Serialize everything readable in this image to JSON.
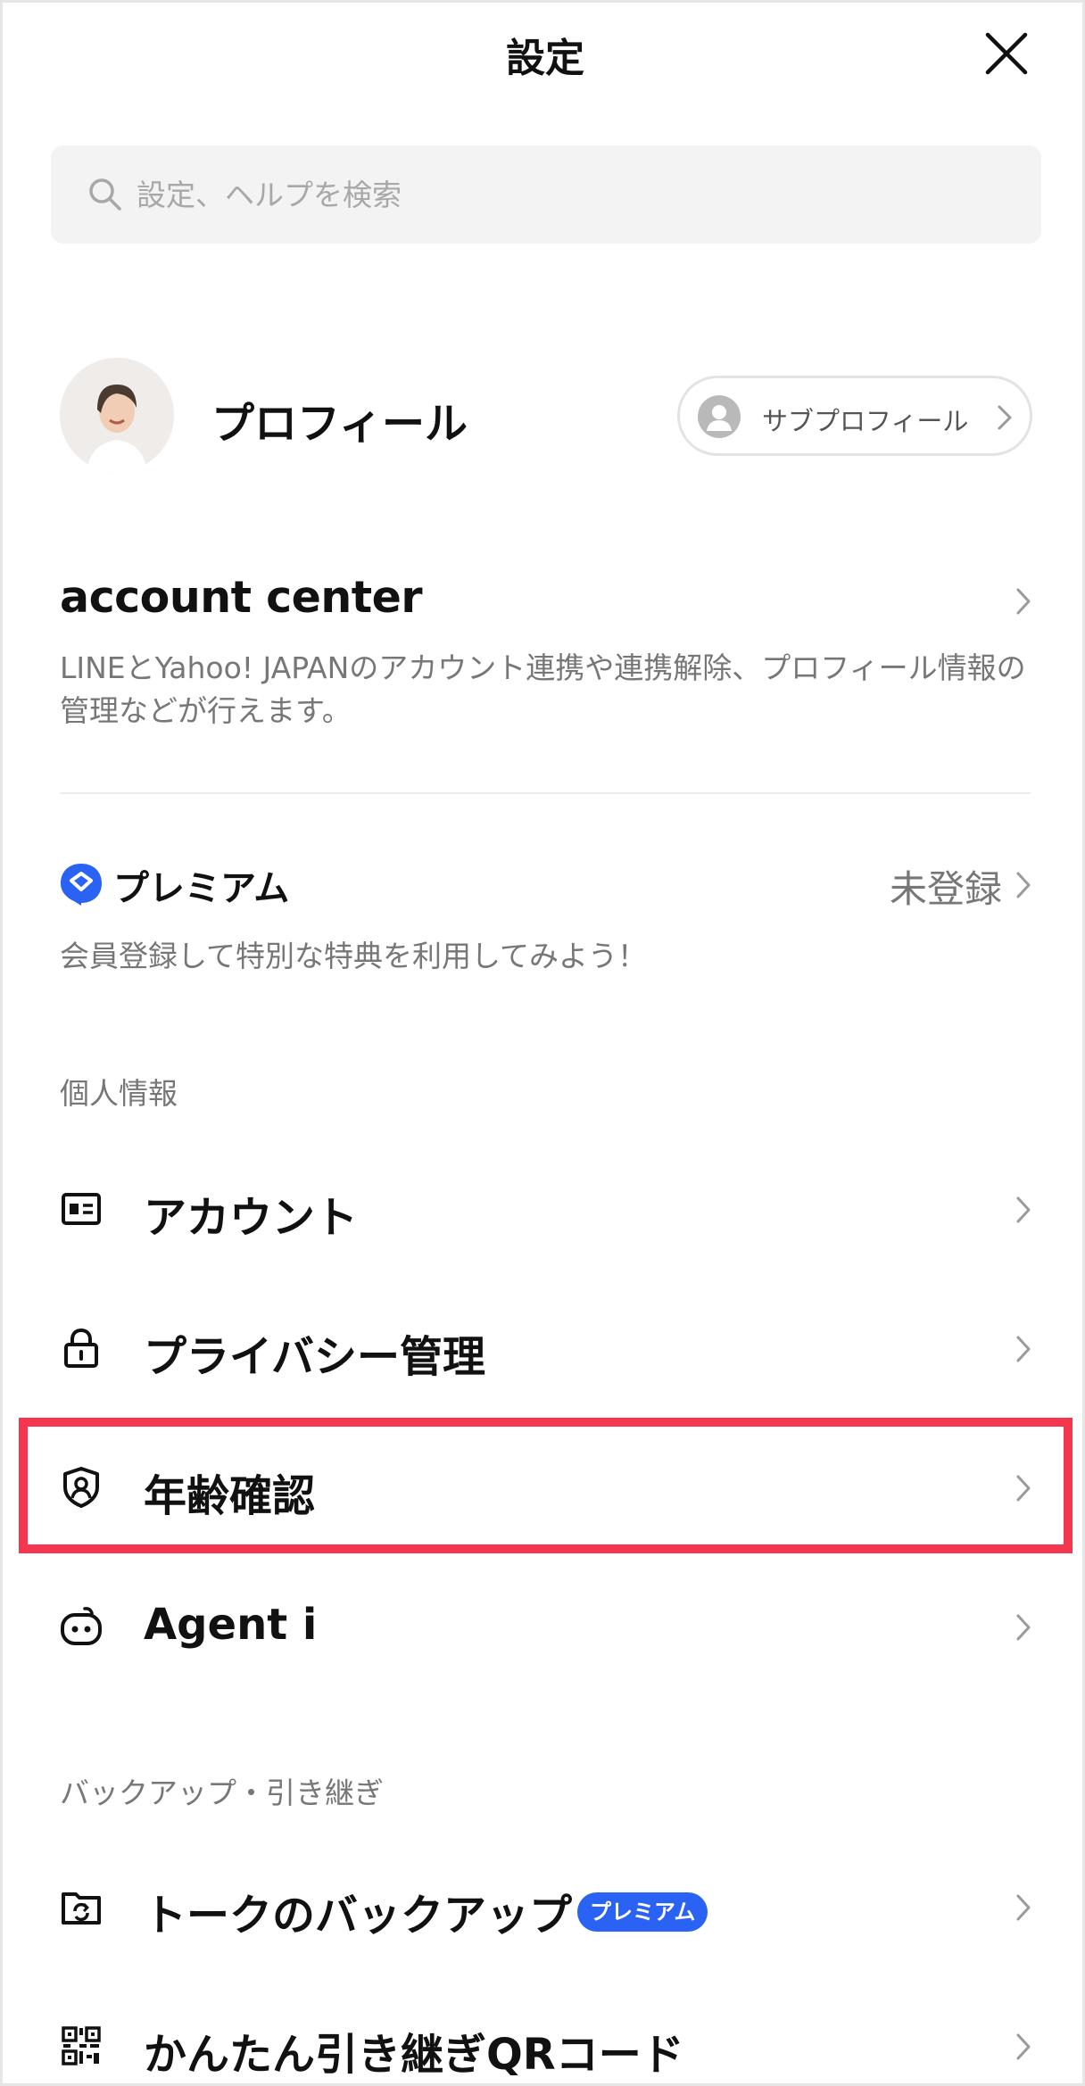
{
  "header": {
    "title": "設定"
  },
  "search": {
    "placeholder": "設定、ヘルプを検索"
  },
  "profile": {
    "name": "プロフィール",
    "subprofile_label": "サブプロフィール"
  },
  "account_center": {
    "title": "account center",
    "description": "LINEとYahoo! JAPANのアカウント連携や連携解除、プロフィール情報の管理などが行えます。"
  },
  "premium": {
    "logo_text": "プレミアム",
    "status": "未登録",
    "description": "会員登録して特別な特典を利用してみよう！"
  },
  "sections": {
    "personal": {
      "label": "個人情報"
    },
    "backup": {
      "label": "バックアップ・引き継ぎ"
    }
  },
  "menu": {
    "account": {
      "label": "アカウント",
      "icon": "id-card-icon"
    },
    "privacy": {
      "label": "プライバシー管理",
      "icon": "lock-icon"
    },
    "age": {
      "label": "年齢確認",
      "icon": "shield-person-icon"
    },
    "agent": {
      "label": "Agent i",
      "icon": "robot-icon"
    },
    "talk_backup": {
      "label": "トークのバックアップ",
      "badge": "プレミアム",
      "icon": "backup-icon"
    },
    "qr_transfer": {
      "label": "かんたん引き継ぎQRコード",
      "icon": "qr-code-icon"
    }
  },
  "colors": {
    "highlight": "#f5364f",
    "premium_blue": "#2a62f4"
  }
}
